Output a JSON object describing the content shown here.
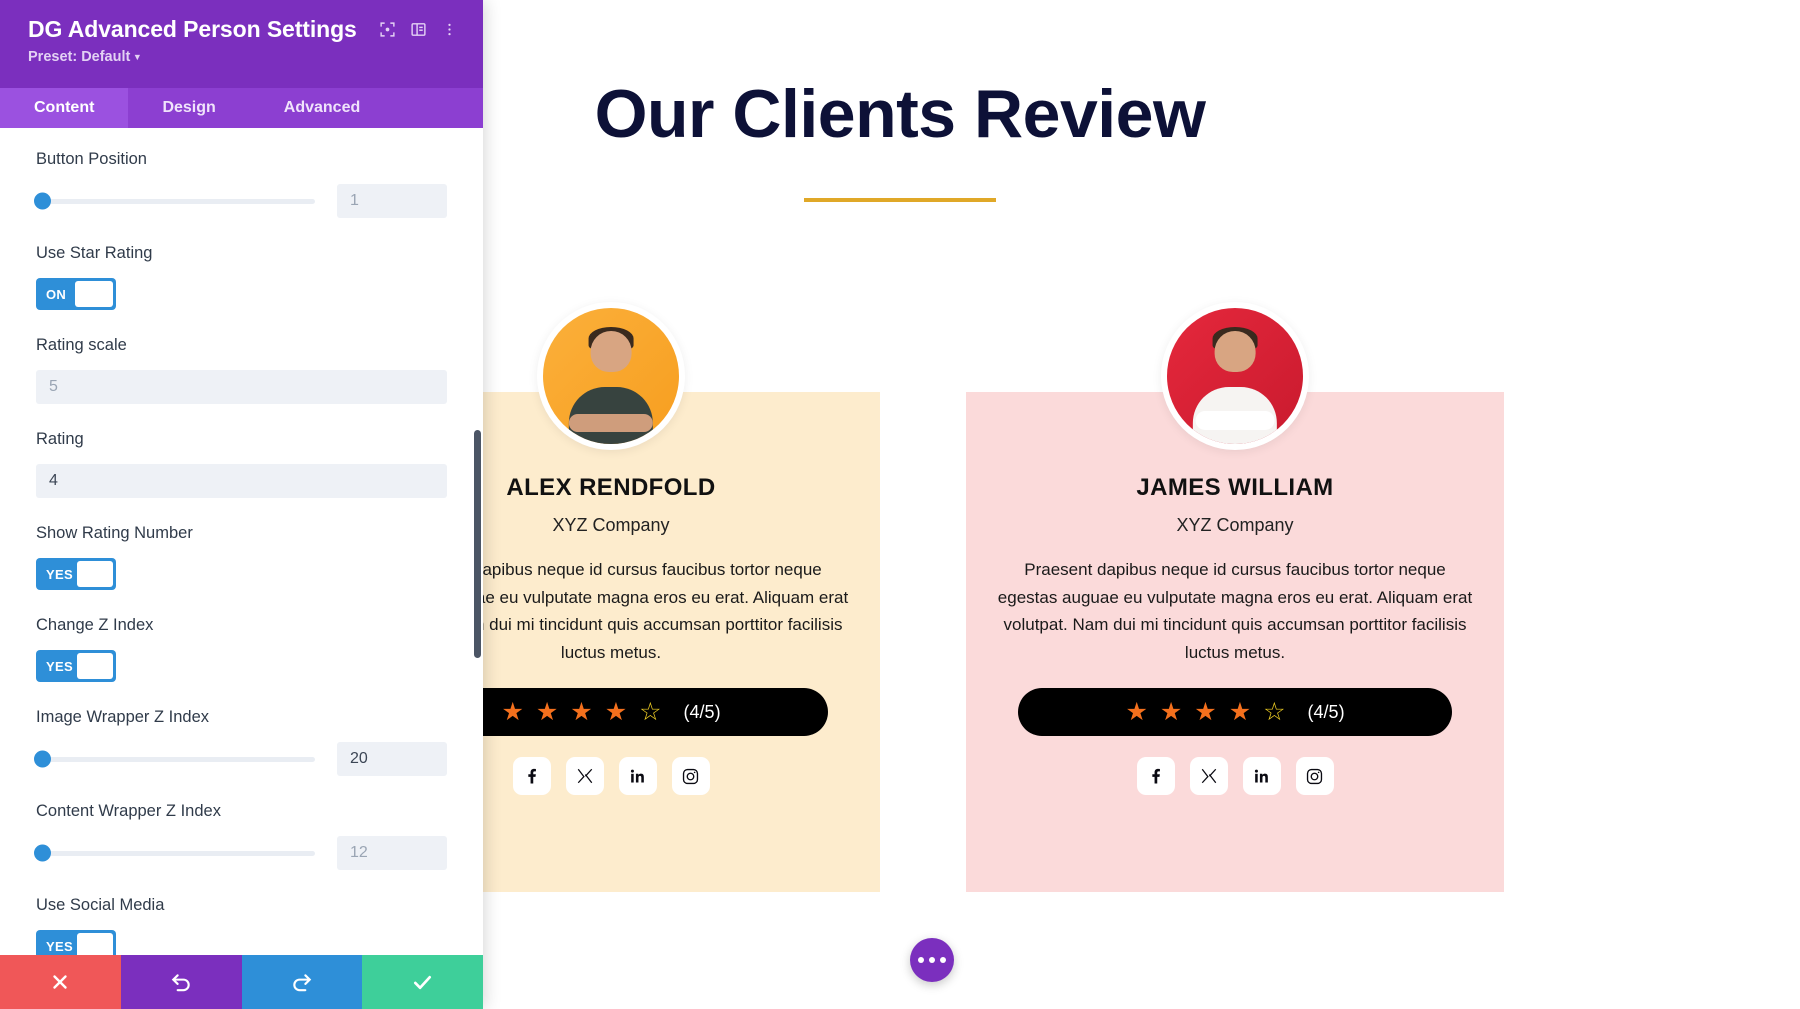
{
  "panel": {
    "title": "DG Advanced Person Settings",
    "preset_label": "Preset: Default",
    "header_icons": [
      "focus-icon",
      "layout-icon",
      "more-vertical-icon"
    ],
    "tabs": [
      {
        "label": "Content",
        "active": true
      },
      {
        "label": "Design",
        "active": false
      },
      {
        "label": "Advanced",
        "active": false
      }
    ],
    "fields": [
      {
        "type": "slider",
        "label": "Button Position",
        "value": "1",
        "is_placeholder": true
      },
      {
        "type": "toggle",
        "label": "Use Star Rating",
        "value": "ON"
      },
      {
        "type": "text",
        "label": "Rating scale",
        "value": "5",
        "is_placeholder": true
      },
      {
        "type": "text",
        "label": "Rating",
        "value": "4",
        "is_placeholder": false
      },
      {
        "type": "toggle",
        "label": "Show Rating Number",
        "value": "YES"
      },
      {
        "type": "toggle",
        "label": "Change Z Index",
        "value": "YES"
      },
      {
        "type": "slider",
        "label": "Image Wrapper Z Index",
        "value": "20",
        "is_placeholder": false
      },
      {
        "type": "slider",
        "label": "Content Wrapper Z Index",
        "value": "12",
        "is_placeholder": true
      },
      {
        "type": "toggle",
        "label": "Use Social Media",
        "value": "YES"
      }
    ],
    "footer": [
      {
        "name": "cancel-button",
        "icon": "close-icon",
        "color": "#f05758"
      },
      {
        "name": "undo-button",
        "icon": "undo-icon",
        "color": "#7b2fbe"
      },
      {
        "name": "redo-button",
        "icon": "redo-icon",
        "color": "#2e8fd8"
      },
      {
        "name": "save-button",
        "icon": "check-icon",
        "color": "#3ecf9a"
      }
    ]
  },
  "page": {
    "heading": "Our Clients Review",
    "heading_color": "#0d1137",
    "underline_color": "#e0a828",
    "fab_label": "more-options",
    "cards": [
      {
        "name": "ALEX RENDFOLD",
        "company": "XYZ Company",
        "text": "Praesent dapibus neque id cursus faucibus tortor neque egestas auguae eu vulputate magna eros eu erat. Aliquam erat volutpat. Nam dui mi tincidunt quis accumsan porttitor facilisis luctus metus.",
        "bg_color": "#fdeccd",
        "avatar_bg": "#f79e1f",
        "rating": 4,
        "rating_scale": 5,
        "rating_text": "(4/5)",
        "socials": [
          "facebook-icon",
          "x-icon",
          "linkedin-icon",
          "instagram-icon"
        ]
      },
      {
        "name": "JAMES WILLIAM",
        "company": "XYZ Company",
        "text": "Praesent dapibus neque id cursus faucibus tortor neque egestas auguae eu vulputate magna eros eu erat. Aliquam erat volutpat. Nam dui mi tincidunt quis accumsan porttitor facilisis luctus metus.",
        "bg_color": "#fbdada",
        "avatar_bg": "#e5283c",
        "rating": 4,
        "rating_scale": 5,
        "rating_text": "(4/5)",
        "socials": [
          "facebook-icon",
          "x-icon",
          "linkedin-icon",
          "instagram-icon"
        ]
      }
    ]
  }
}
